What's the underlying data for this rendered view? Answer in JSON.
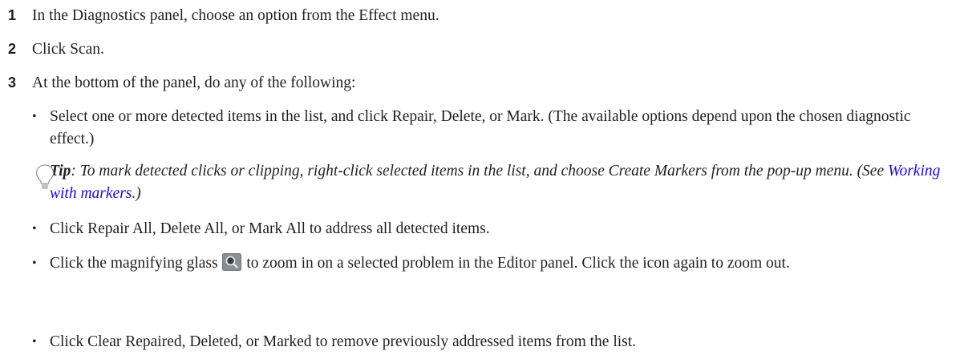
{
  "steps": [
    {
      "num": "1",
      "text": "In the Diagnostics panel, choose an option from the Effect menu."
    },
    {
      "num": "2",
      "text": "Click Scan."
    },
    {
      "num": "3",
      "text": "At the bottom of the panel, do any of the following:"
    }
  ],
  "bullets": {
    "b1": "Select one or more detected items in the list, and click Repair, Delete, or Mark. (The available options depend upon the chosen diagnostic effect.)",
    "b2": "Click Repair All, Delete All, or Mark All to address all detected items.",
    "b3_before": "Click the magnifying glass",
    "b3_after": "to zoom in on a selected problem in the Editor panel. Click the icon again to zoom out.",
    "b4": "Click Clear Repaired, Deleted, or Marked to remove previously addressed items from the list."
  },
  "tip": {
    "label": "Tip",
    "text_before": ": To mark detected clicks or clipping, right-click selected items in the list, and choose Create Markers from the pop-up menu. (See ",
    "link_text": "Working with markers",
    "text_after": ".)"
  },
  "bullet_glyph": "•",
  "icons": {
    "tip": "lightbulb-icon",
    "magnify": "magnifying-glass-icon"
  },
  "colors": {
    "text": "#231f20",
    "link": "#1a0dde",
    "icon_bg": "#8a8f95"
  }
}
